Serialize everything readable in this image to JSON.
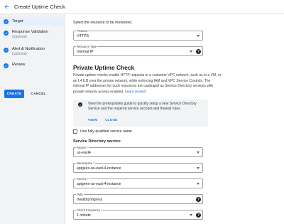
{
  "header": {
    "title": "Create Uptime Check"
  },
  "sidebar": {
    "steps": [
      {
        "label": "Target",
        "sub": ""
      },
      {
        "label": "Response Validation",
        "sub": "(optional)"
      },
      {
        "label": "Alert & Notification",
        "sub": "(optional)"
      },
      {
        "label": "Review",
        "sub": ""
      }
    ],
    "create_label": "CREATE",
    "cancel_label": "CANCEL"
  },
  "main": {
    "intro": "Select the resource to be monitored.",
    "protocol": {
      "label": "Protocol",
      "value": "HTTPS"
    },
    "resource_type": {
      "label": "Resource Type",
      "value": "Internal IP"
    },
    "section_title": "Private Uptime Check",
    "paragraph": "Private uptime checks enable HTTP requests to a customer VPC network, such as to a VM, or an L4 ILB over the private network, while enforcing IAM and VPC Service Controls. The internal IP addresses for such resources are cataloged as Service Directory services with private network access enabled.",
    "learn_more": "Learn more",
    "info": {
      "message": "View the prerequisites guide to quickly setup a new Service Directory Service and the required service account and firewall rules.",
      "view": "VIEW",
      "close": "CLOSE"
    },
    "fqdn_label": "Use fully qualified service name",
    "sd_title": "Service Directory service",
    "region": {
      "label": "Region *",
      "value": "us-east4"
    },
    "namespace": {
      "label": "Namespace *",
      "value": "apigeex-us-east-4-instance"
    },
    "service": {
      "label": "Service *",
      "value": "apigeex-us-east-4-instance"
    },
    "path": {
      "label": "Path",
      "value": "/healthz/ingress"
    },
    "frequency": {
      "label": "Check Frequency",
      "value": "1 minute"
    }
  },
  "colors": {
    "accent": "#1a73e8",
    "sidebar_bg": "#f1f3f4",
    "active_step_bg": "#e8f0fe"
  }
}
